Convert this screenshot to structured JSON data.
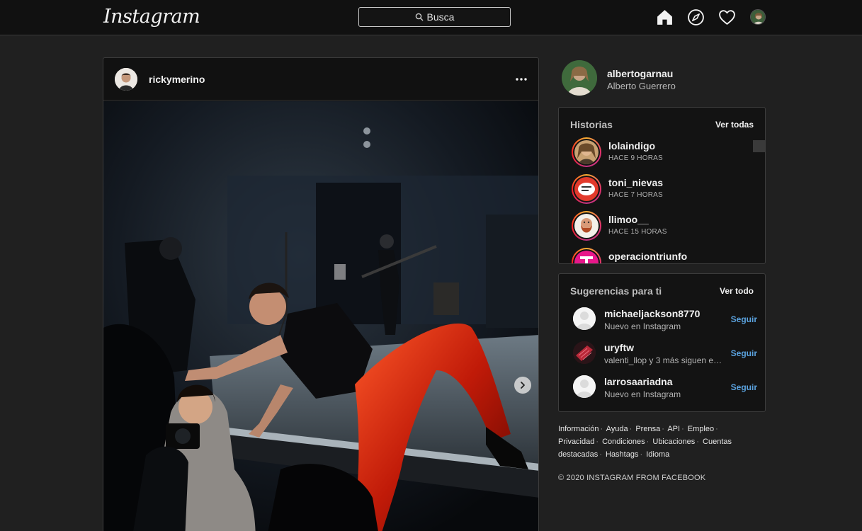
{
  "header": {
    "logo_text": "Instagram",
    "search_placeholder": "Busca"
  },
  "post": {
    "username": "rickymerino"
  },
  "profile": {
    "username": "albertogarnau",
    "full_name": "Alberto Guerrero"
  },
  "stories": {
    "title": "Historias",
    "view_all": "Ver todas",
    "items": [
      {
        "username": "lolaindigo",
        "time": "HACE 9 HORAS"
      },
      {
        "username": "toni_nievas",
        "time": "HACE 7 HORAS"
      },
      {
        "username": "llimoo__",
        "time": "HACE 15 HORAS"
      },
      {
        "username": "operaciontriunfo",
        "time": ""
      }
    ]
  },
  "suggestions": {
    "title": "Sugerencias para ti",
    "view_all": "Ver todo",
    "follow_label": "Seguir",
    "items": [
      {
        "username": "michaeljackson8770",
        "subtitle": "Nuevo en Instagram"
      },
      {
        "username": "uryftw",
        "subtitle": "valenti_llop y 3 más siguen es..."
      },
      {
        "username": "larrosaariadna",
        "subtitle": "Nuevo en Instagram"
      }
    ]
  },
  "footer": {
    "links": [
      "Información",
      "Ayuda",
      "Prensa",
      "API",
      "Empleo",
      "Privacidad",
      "Condiciones",
      "Ubicaciones",
      "Cuentas destacadas",
      "Hashtags",
      "Idioma"
    ],
    "copyright": "© 2020 INSTAGRAM FROM FACEBOOK"
  },
  "colors": {
    "background": "#202020",
    "bar": "#111111",
    "link_blue": "#5aa1dd"
  },
  "icons": {
    "nav": [
      "home-icon",
      "explore-compass-icon",
      "heart-icon",
      "profile-avatar"
    ],
    "post": [
      "more-options-icon",
      "next-arrow-icon"
    ]
  }
}
